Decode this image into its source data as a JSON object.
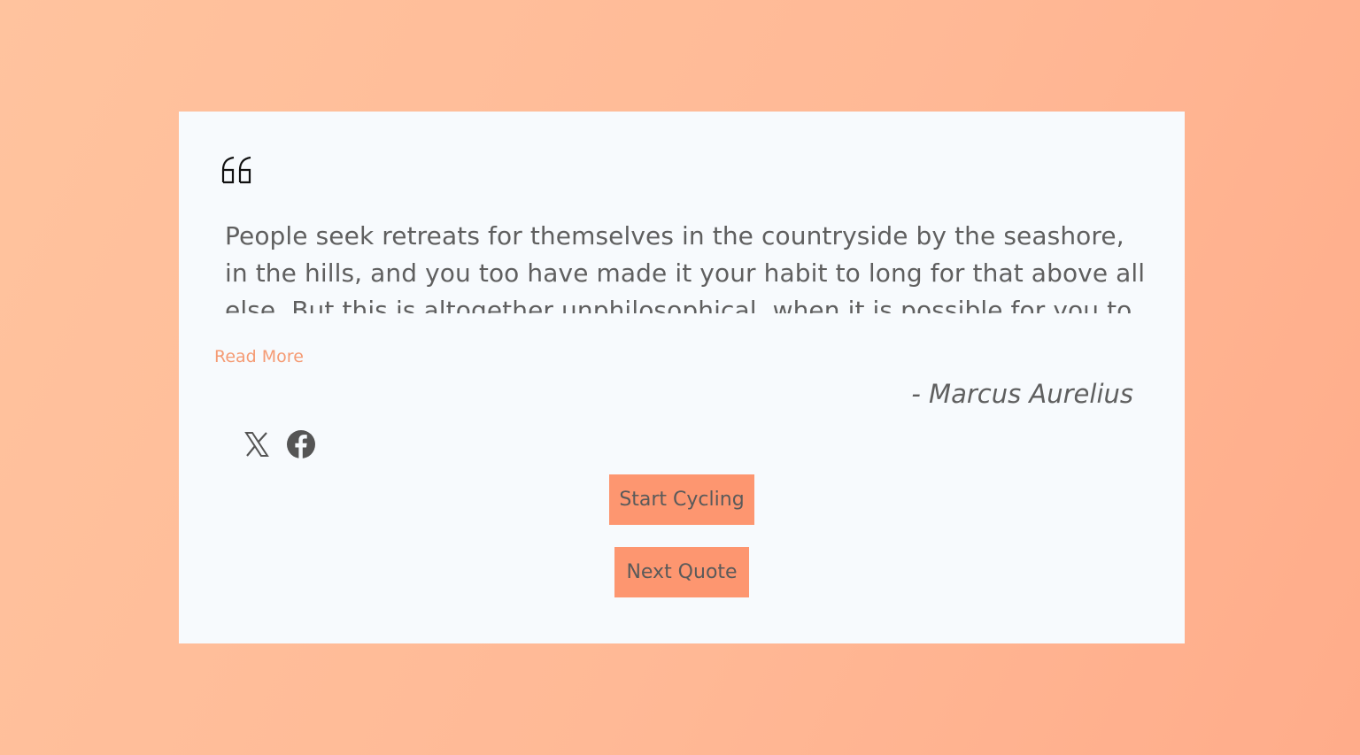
{
  "quote": {
    "text": "People seek retreats for themselves in the countryside by the seashore, in the hills, and you too have made it your habit to long for that above all else. But this is altogether unphilosophical, when it is possible for you to retreat into yourself whenever you please.",
    "author": "- Marcus Aurelius",
    "read_more_label": "Read More"
  },
  "social": {
    "x_icon": "x-twitter-icon",
    "facebook_icon": "facebook-icon"
  },
  "buttons": {
    "start_cycling_label": "Start Cycling",
    "next_quote_label": "Next Quote"
  },
  "colors": {
    "accent": "#fd9670",
    "link": "#f59b74",
    "text": "#5f5f5f",
    "card": "#f7fafd"
  }
}
